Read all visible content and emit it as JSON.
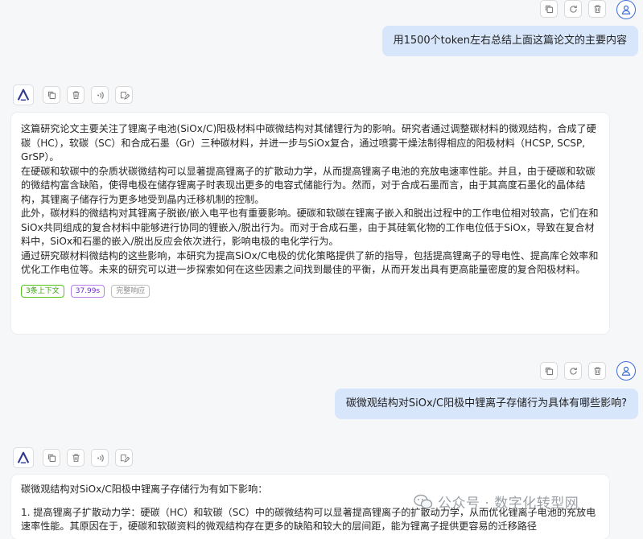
{
  "messages": [
    {
      "role": "user",
      "text": "用1500个token左右总结上面这篇论文的主要内容"
    },
    {
      "role": "assistant",
      "paragraphs": [
        "这篇研究论文主要关注了锂离子电池(SiOx/C)阳极材料中碳微结构对其储锂行为的影响。研究者通过调整碳材料的微观结构，合成了硬碳（HC），软碳（SC）和合成石墨（Gr）三种碳材料，并进一步与SiOx复合，通过喷雾干燥法制得相应的阳极材料（HCSP, SCSP, GrSP）。",
        "在硬碳和软碳中的杂质状碳微结构可以显著提高锂离子的扩散动力学，从而提高锂离子电池的充放电速率性能。并且，由于硬碳和软碳的微结构富含缺陷，使得电极在储存锂离子时表现出更多的电容式储能行为。然而，对于合成石墨而言，由于其高度石墨化的晶体结构，其锂离子储存行为更多地受到晶内迁移机制的控制。",
        "此外，碳材料的微结构对其锂离子脱嵌/嵌入电平也有重要影响。硬碳和软碳在锂离子嵌入和脱出过程中的工作电位相对较高，它们在和SiOx共同组成的复合材料中能够进行协同的锂嵌入/脱出行为。而对于合成石墨，由于其硅氧化物的工作电位低于SiOx，导致在复合材料中，SiOx和石墨的嵌入/脱出反应会依次进行，影响电极的电化学行为。",
        "通过研究碳材料微结构的这些影响，本研究为提高SiOx/C电极的优化策略提供了新的指导，包括提高锂离子的导电性、提高库仑效率和优化工作电位等。未来的研究可以进一步探索如何在这些因素之间找到最佳的平衡，从而开发出具有更高能量密度的复合阳极材料。"
      ],
      "tags": [
        "3条上下文",
        "37.99s",
        "完整响应"
      ]
    },
    {
      "role": "user",
      "text": "碳微观结构对SiOx/C阳极中锂离子存储行为具体有哪些影响?"
    },
    {
      "role": "assistant",
      "paragraphs": [
        "碳微观结构对SiOx/C阳极中锂离子存储行为有如下影响：",
        "1. 提高锂离子扩散动力学：硬碳（HC）和软碳（SC）中的碳微结构可以显著提高锂离子的扩散动力学，从而优化锂离子电池的充放电速率性能。其原因在于，硬碳和软碳资料的微观结构存在更多的缺陷和较大的层间距，能为锂离子提供更容易的迁移路径"
      ]
    }
  ],
  "watermark": "公众号 · 数字化转型网",
  "icons": {
    "user_actions": [
      "copy-icon",
      "refresh-icon",
      "delete-icon"
    ],
    "bot_actions": [
      "copy-icon",
      "delete-icon",
      "speaker-icon",
      "edit-icon"
    ],
    "user_avatar": "user-icon",
    "bot_avatar": "openai-logo-icon"
  },
  "colors": {
    "accent": "#3d6bd6",
    "user_bubble": "#d8e6fb",
    "tag_green": "#52c41a",
    "tag_purple": "#b37feb"
  }
}
